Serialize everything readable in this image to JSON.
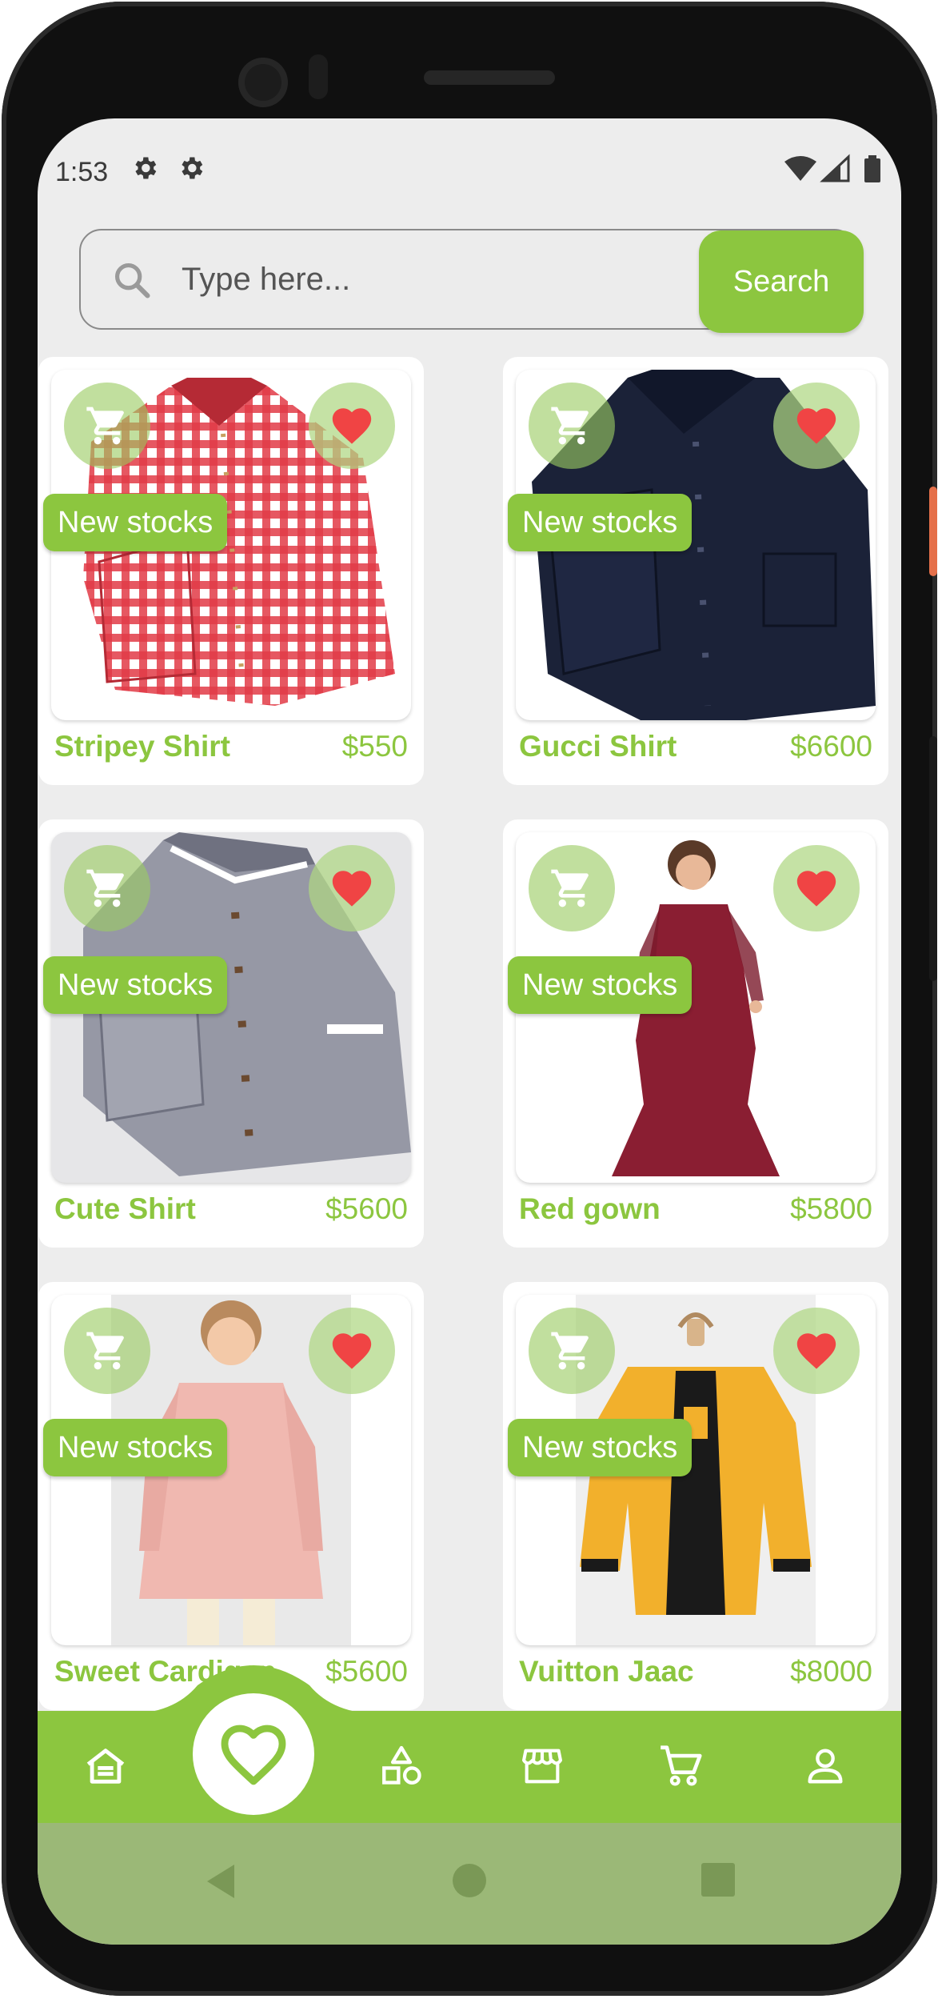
{
  "status_bar": {
    "time": "1:53"
  },
  "search": {
    "placeholder": "Type here...",
    "button_label": "Search"
  },
  "products": [
    {
      "name": "Stripey Shirt",
      "price": "$550",
      "badge": "New stocks",
      "image": "red-plaid-shirt"
    },
    {
      "name": "Gucci Shirt",
      "price": "$6600",
      "badge": "New stocks",
      "image": "navy-corduroy-shirt"
    },
    {
      "name": "Cute Shirt",
      "price": "$5600",
      "badge": "New stocks",
      "image": "grey-collar-shirt"
    },
    {
      "name": "Red gown",
      "price": "$5800",
      "badge": "New stocks",
      "image": "burgundy-sequin-gown"
    },
    {
      "name": "Sweet Cardigan",
      "price": "$5600",
      "badge": "New stocks",
      "image": "pink-girls-jacket"
    },
    {
      "name": "Vuitton Jaac",
      "price": "$8000",
      "badge": "New stocks",
      "image": "yellow-hooded-jacket"
    }
  ],
  "bottom_nav": {
    "items": [
      "home-icon",
      "favorites-icon",
      "categories-icon",
      "store-icon",
      "cart-icon",
      "profile-icon"
    ],
    "active": "favorites-icon"
  },
  "colors": {
    "accent": "#8cc63f",
    "heart": "#f04444",
    "system_nav": "#9bb877"
  }
}
